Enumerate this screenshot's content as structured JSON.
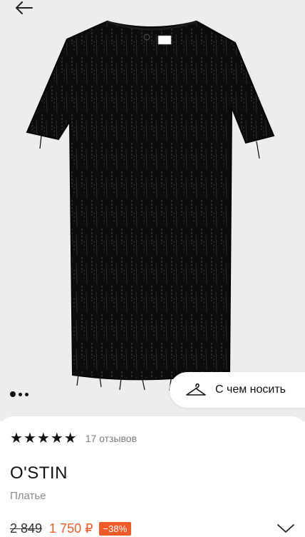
{
  "product": {
    "image_alt_icon": "dress-photo",
    "gallery_dots": 3,
    "gallery_active": 1
  },
  "wear_button": {
    "label": "С чем носить",
    "icon": "hanger-icon"
  },
  "rating": {
    "stars": 5,
    "reviews_label": "17 отзывов"
  },
  "brand": "O'STIN",
  "type": "Платье",
  "price": {
    "old": "2 849",
    "new": "1 750 ₽",
    "discount": "−38%",
    "accent_color": "#f05a28"
  },
  "icons": {
    "back": "arrow-left-icon",
    "expand": "chevron-down-icon"
  }
}
